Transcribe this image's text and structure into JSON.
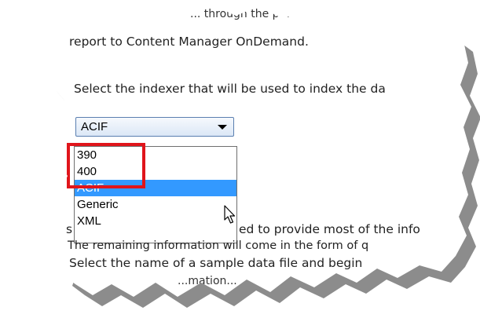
{
  "text_lines": {
    "line1": "... through the p...",
    "line2": "report to Content Manager OnDemand.",
    "line3": "Select the indexer that will be used to index the da",
    "line4a": "s",
    "line4b": "ed to provide most of the info",
    "line5a": "The remaining information will come in the form of q",
    "line6": "Select the name of a sample data file and begin",
    "line7": "...mation..."
  },
  "indexer_select": {
    "value": "ACIF",
    "options": [
      "390",
      "400",
      "ACIF",
      "Generic",
      "XML"
    ],
    "selected_index": 2
  },
  "annotation": {
    "highlight_color": "#e0151b",
    "highlighted_options": [
      "390",
      "400"
    ]
  },
  "colors": {
    "selection": "#3399ff",
    "combo_border": "#5a7fb0"
  }
}
